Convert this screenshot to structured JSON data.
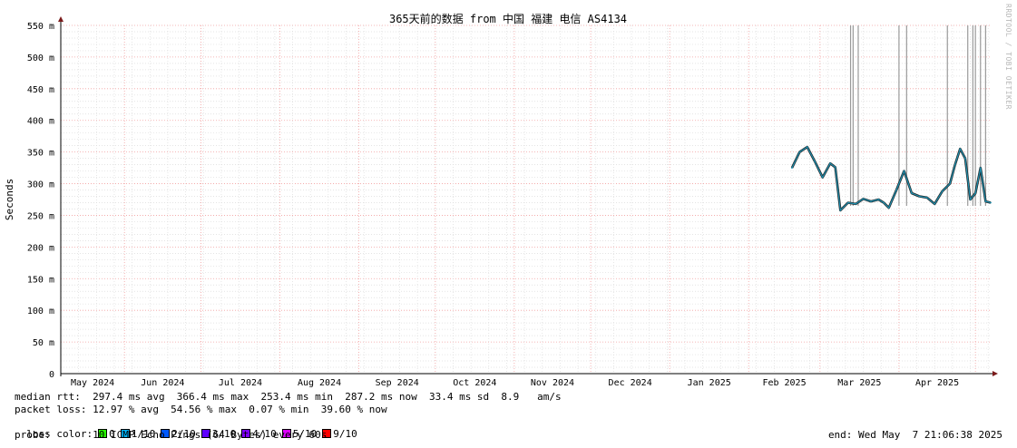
{
  "chart_data": {
    "type": "line",
    "title": "365天前的数据 from 中国 福建 电信 AS4134",
    "ylabel": "Seconds",
    "ylim": [
      0,
      550
    ],
    "y_ticks": [
      "0",
      "50 m",
      "100 m",
      "150 m",
      "200 m",
      "250 m",
      "300 m",
      "350 m",
      "400 m",
      "450 m",
      "500 m",
      "550 m"
    ],
    "x_ticks": [
      "May 2024",
      "Jun 2024",
      "Jul 2024",
      "Aug 2024",
      "Sep 2024",
      "Oct 2024",
      "Nov 2024",
      "Dec 2024",
      "Jan 2025",
      "Feb 2025",
      "Mar 2025",
      "Apr 2025"
    ],
    "xlim": [
      "2024-05-07",
      "2025-05-07"
    ],
    "grid": true,
    "series": [
      {
        "name": "median rtt",
        "color": "#1e90b0",
        "x": [
          "2025-02-18",
          "2025-02-21",
          "2025-02-24",
          "2025-02-27",
          "2025-03-02",
          "2025-03-05",
          "2025-03-07",
          "2025-03-09",
          "2025-03-12",
          "2025-03-15",
          "2025-03-18",
          "2025-03-21",
          "2025-03-24",
          "2025-03-26",
          "2025-03-28",
          "2025-03-31",
          "2025-04-03",
          "2025-04-06",
          "2025-04-09",
          "2025-04-12",
          "2025-04-15",
          "2025-04-18",
          "2025-04-21",
          "2025-04-23",
          "2025-04-25",
          "2025-04-27",
          "2025-04-29",
          "2025-05-01",
          "2025-05-03",
          "2025-05-05",
          "2025-05-07"
        ],
        "y": [
          325,
          350,
          358,
          335,
          310,
          332,
          326,
          258,
          270,
          268,
          276,
          272,
          275,
          270,
          262,
          290,
          320,
          285,
          280,
          278,
          268,
          288,
          300,
          330,
          355,
          340,
          275,
          285,
          325,
          272,
          270
        ]
      }
    ],
    "loss_spikes": [
      "2025-03-13",
      "2025-03-14",
      "2025-03-16",
      "2025-04-01",
      "2025-04-04",
      "2025-04-20",
      "2025-04-28",
      "2025-04-30",
      "2025-05-01",
      "2025-05-03",
      "2025-05-05"
    ]
  },
  "stats": {
    "median_rtt": "median rtt:  297.4 ms avg  366.4 ms max  253.4 ms min  287.2 ms now  33.4 ms sd  8.9   am/s",
    "packet_loss": "packet loss: 12.97 % avg  54.56 % max  0.07 % min  39.60 % now",
    "loss_color_label": "loss color:",
    "probe": "probe:       10 ICMP Echo Pings (64 Bytes) every 60s",
    "end": "end: Wed May  7 21:06:38 2025"
  },
  "loss_legend": [
    {
      "label": "0",
      "color": "#26ff00"
    },
    {
      "label": "1/10",
      "color": "#00b8ff"
    },
    {
      "label": "2/10",
      "color": "#0059ff"
    },
    {
      "label": "3/10",
      "color": "#5e00ff"
    },
    {
      "label": "4/10",
      "color": "#7e00ff"
    },
    {
      "label": "5/10",
      "color": "#dd00ff"
    },
    {
      "label": "9/10",
      "color": "#ff0000"
    }
  ],
  "watermark": "RRDTOOL / TOBI OETIKER"
}
